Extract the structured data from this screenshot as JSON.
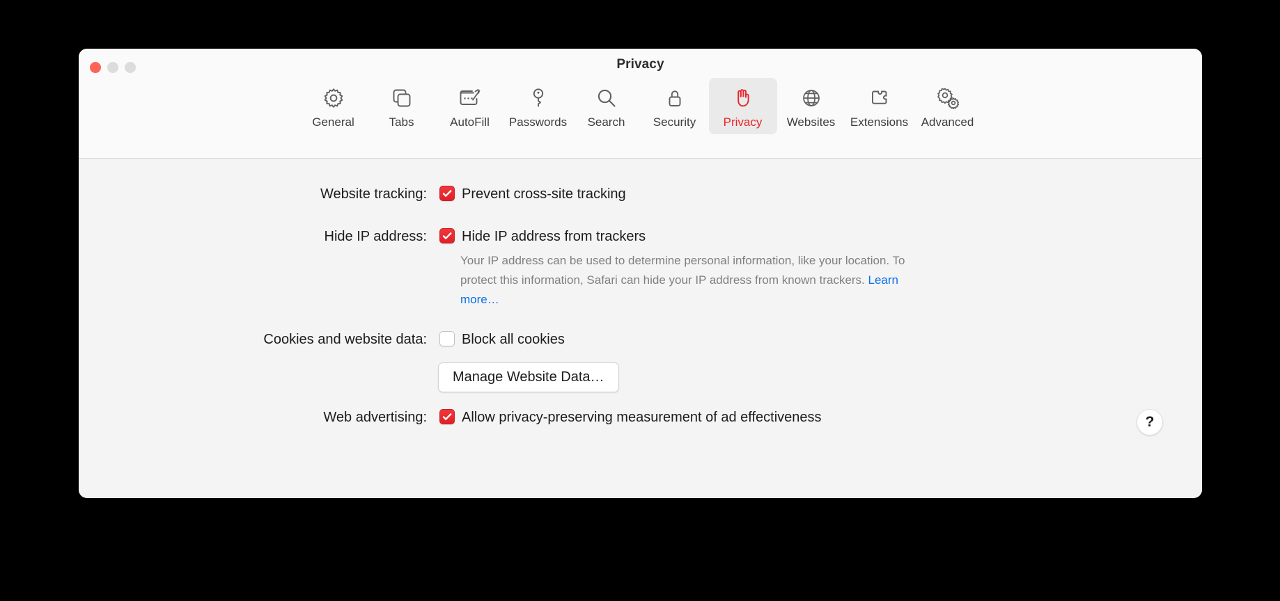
{
  "window": {
    "title": "Privacy",
    "traffic_lights": {
      "close": "close",
      "minimize": "minimize",
      "zoom": "zoom"
    }
  },
  "colors": {
    "accent_red": "#e02127",
    "link_blue": "#0a6fe8",
    "toolbar_bg": "#fafafa",
    "content_bg": "#f4f4f4",
    "selected_tab_bg": "#eaeaea"
  },
  "toolbar": {
    "items": [
      {
        "label": "General",
        "icon": "gear-icon",
        "selected": false
      },
      {
        "label": "Tabs",
        "icon": "tabs-icon",
        "selected": false
      },
      {
        "label": "AutoFill",
        "icon": "autofill-icon",
        "selected": false
      },
      {
        "label": "Passwords",
        "icon": "key-icon",
        "selected": false
      },
      {
        "label": "Search",
        "icon": "magnifier-icon",
        "selected": false
      },
      {
        "label": "Security",
        "icon": "lock-icon",
        "selected": false
      },
      {
        "label": "Privacy",
        "icon": "hand-icon",
        "selected": true
      },
      {
        "label": "Websites",
        "icon": "globe-icon",
        "selected": false
      },
      {
        "label": "Extensions",
        "icon": "puzzle-piece-icon",
        "selected": false
      },
      {
        "label": "Advanced",
        "icon": "gears-icon",
        "selected": false
      }
    ]
  },
  "settings": {
    "website_tracking": {
      "label": "Website tracking:",
      "checkbox_label": "Prevent cross-site tracking",
      "checked": true
    },
    "hide_ip": {
      "label": "Hide IP address:",
      "checkbox_label": "Hide IP address from trackers",
      "checked": true,
      "description_before": "Your IP address can be used to determine personal information, like your location. To protect this information, Safari can hide your IP address from known trackers. ",
      "learn_more": "Learn more…"
    },
    "cookies": {
      "label": "Cookies and website data:",
      "checkbox_label": "Block all cookies",
      "checked": false,
      "button": "Manage Website Data…"
    },
    "web_advertising": {
      "label": "Web advertising:",
      "checkbox_label": "Allow privacy-preserving measurement of ad effectiveness",
      "checked": true
    }
  },
  "help": {
    "label": "?"
  }
}
